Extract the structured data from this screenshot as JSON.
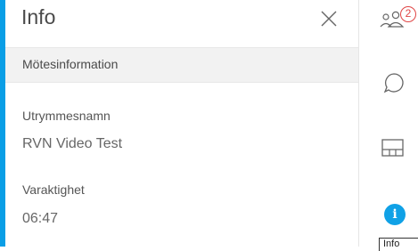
{
  "panel": {
    "title": "Info",
    "section_header": "Mötesinformation",
    "fields": [
      {
        "label": "Utrymmesnamn",
        "value": "RVN Video Test"
      },
      {
        "label": "Varaktighet",
        "value": "06:47"
      }
    ]
  },
  "rail": {
    "participants_badge": "2",
    "info_icon_glyph": "i",
    "tooltip": "Info"
  },
  "colors": {
    "accent": "#0a9ee6",
    "info_active": "#10a1e6",
    "badge": "#e04545"
  },
  "icons": [
    "close-icon",
    "participants-icon",
    "chat-icon",
    "layout-icon",
    "info-icon"
  ]
}
